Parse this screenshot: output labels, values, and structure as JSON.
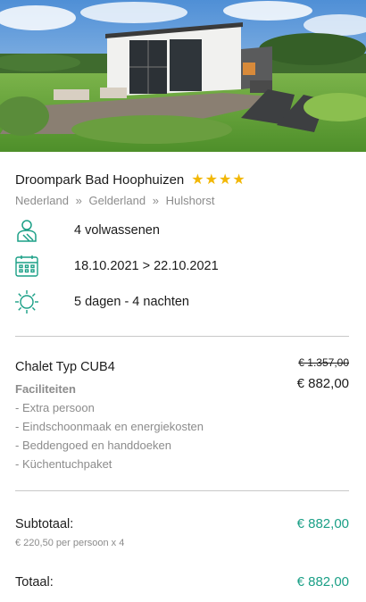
{
  "hero": {
    "image": "holiday-chalet-photo"
  },
  "park": {
    "name": "Droompark Bad Hoophuizen",
    "stars": 4,
    "breadcrumb": [
      "Nederland",
      "Gelderland",
      "Hulshorst"
    ],
    "breadcrumb_sep": "»"
  },
  "details": {
    "guests": "4 volwassenen",
    "dates": "18.10.2021 > 22.10.2021",
    "duration": "5 dagen - 4 nachten"
  },
  "icons": {
    "guests": "person-icon",
    "dates": "calendar-icon",
    "duration": "sun-icon"
  },
  "accommodation": {
    "name": "Chalet Typ CUB4",
    "old_price": "€ 1.357,00",
    "price": "€ 882,00",
    "facilities_title": "Faciliteiten",
    "facilities": [
      "- Extra persoon",
      "- Eindschoonmaak en energiekosten",
      "- Beddengoed en handdoeken",
      "- Küchentuchpaket"
    ]
  },
  "summary": {
    "subtotal_label": "Subtotaal:",
    "subtotal_price": "€ 882,00",
    "subtotal_detail": "€ 220,50 per persoon x 4",
    "total_label": "Totaal:",
    "total_price": "€ 882,00"
  },
  "colors": {
    "accent": "#1a9f86",
    "star": "#f2b705",
    "muted": "#8c8c8c"
  }
}
